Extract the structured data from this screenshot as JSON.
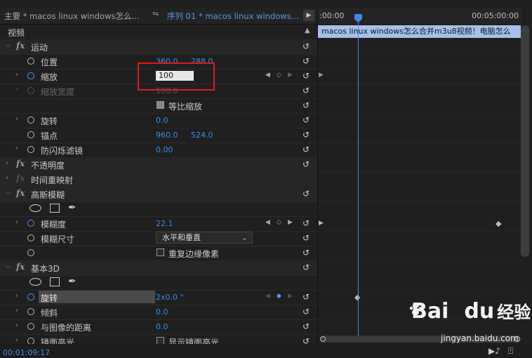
{
  "header": {
    "master_tab": "主要 * macos linux  windows怎么...",
    "tab_arrow": "⇋",
    "sequence_tab": "序列 01 * macos linux  windows...",
    "nav_arrow": "▶"
  },
  "timeline": {
    "start_time": ":00:00",
    "end_time": "00:05:00:00",
    "clip_label": "macos linux  windows怎么合并m3u8视频！电脑怎么",
    "playhead_time": "00:01:09:17"
  },
  "panel": {
    "video_header": "视频",
    "reset_glyph": "↺",
    "sections": {
      "motion": "运动",
      "opacity": "不透明度",
      "time_remap": "时间重映射",
      "gaussian_blur": "高斯模糊",
      "basic3d": "基本3D"
    },
    "props": {
      "position": {
        "label": "位置",
        "x": "360.0",
        "y": "288.0"
      },
      "scale": {
        "label": "缩放",
        "value": "100"
      },
      "scale_width": {
        "label": "缩放宽度",
        "value": "100.0"
      },
      "uniform_scale": {
        "label": "等比缩放"
      },
      "rotation": {
        "label": "旋转",
        "value": "0.0"
      },
      "anchor": {
        "label": "锚点",
        "x": "960.0",
        "y": "524.0"
      },
      "antiflicker": {
        "label": "防闪烁滤镜",
        "value": "0.00"
      },
      "blurriness": {
        "label": "模糊度",
        "value": "22.1"
      },
      "blur_dimension": {
        "label": "模糊尺寸",
        "value": "水平和垂直"
      },
      "repeat_edge": {
        "label": "重复边缘像素"
      },
      "swivel": {
        "label": "旋转",
        "value": "2x0.0 °"
      },
      "tilt": {
        "label": "倾斜",
        "value": "0.0"
      },
      "distance": {
        "label": "与图像的距离",
        "value": "0.0"
      },
      "specular": {
        "label": "镜面高光"
      },
      "show_specular": {
        "label": "显示镜面高光"
      }
    }
  },
  "watermark": {
    "brand_a": "Bai",
    "brand_b": "du",
    "brand_cn": "经验",
    "url": "jingyan.baidu.com"
  },
  "colors": {
    "accent_blue": "#3b8eea",
    "highlight_red": "#e01b1b",
    "clip_blue": "#a6c0e8"
  }
}
